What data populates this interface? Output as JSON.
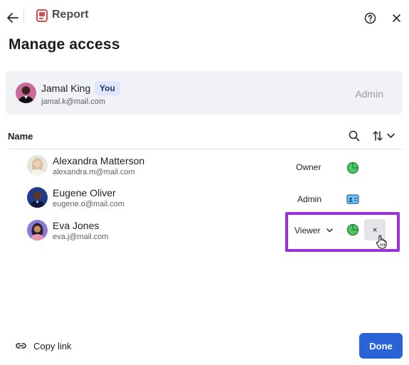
{
  "header": {
    "app_name": "Report",
    "app_icon": "report-icon",
    "back_icon": "arrow-left-icon",
    "help_icon": "question-circle-icon",
    "close_icon": "close-icon",
    "page_title": "Manage access"
  },
  "current_user": {
    "name": "Jamal King",
    "badge": "You",
    "email": "jamal.k@mail.com",
    "role": "Admin"
  },
  "list_header": {
    "name_label": "Name",
    "search_icon": "search-icon",
    "sort_icon": "sort-arrows-icon",
    "sort_dropdown_icon": "chevron-down-icon"
  },
  "members": [
    {
      "name": "Alexandra Matterson",
      "email": "alexandra.m@mail.com",
      "role": "Owner",
      "role_icon": "pie-chart-icon"
    },
    {
      "name": "Eugene Oliver",
      "email": "eugene.o@mail.com",
      "role": "Admin",
      "role_icon": "id-card-icon"
    },
    {
      "name": "Eva Jones",
      "email": "eva.j@mail.com",
      "role": "Viewer",
      "role_icon": "pie-chart-icon",
      "remove_label": "×"
    }
  ],
  "footer": {
    "copy_link_label": "Copy link",
    "copy_link_icon": "link-icon",
    "done_label": "Done"
  },
  "colors": {
    "accent": "#2a63d7",
    "highlight": "#9b30d9",
    "badge_bg": "#dde6fb",
    "role_icon_green": "#4cc764",
    "role_icon_blue": "#2e8fd6"
  }
}
